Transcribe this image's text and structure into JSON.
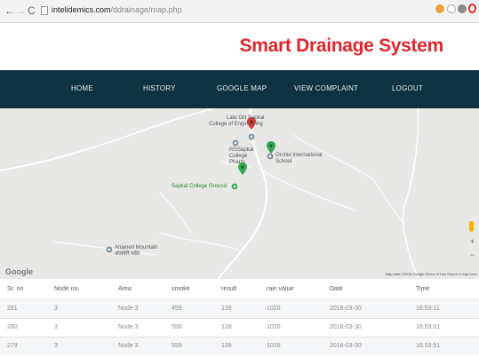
{
  "browser": {
    "back": "←",
    "forward": "→",
    "reload": "C",
    "url_host": "intelidemics.com",
    "url_path": "/ddrainage/map.php"
  },
  "site": {
    "title": "Smart Drainage System",
    "title_color": "#e0262c",
    "nav_color": "#0d3340"
  },
  "nav": {
    "items": [
      "HOME",
      "HISTORY",
      "GOOGLE MAP",
      "VIEW COMPLAINT",
      "LOGOUT"
    ]
  },
  "map": {
    "pois": {
      "late_gn": "Late GN Sapkal College of Engineering",
      "late_gn_l1": "Late GN Sapkal",
      "late_gn_l2": "College of Engineering",
      "rg_l1": "RGSapkal",
      "rg_l2": "College",
      "rg_l3": "Pharm",
      "orchid_l1": "Orchid International",
      "orchid_l2": "School",
      "ground": "Sapkal College Ground",
      "anjaneri_l1": "Anjaneri Mountain",
      "anjaneri_l2": "अंजनेरी पर्वत"
    },
    "logo": "Google",
    "credit": "Map data ©2018 Google   Terms of Use   Report a map error",
    "zoom_in": "+",
    "zoom_out": "−",
    "marker_color": "#e53935",
    "pin_color": "#34a853"
  },
  "table": {
    "headers": [
      "Sr. no",
      "Node no.",
      "Area",
      "smoke",
      "result",
      "rain value",
      "Date",
      "Time"
    ],
    "rows": [
      [
        "281",
        "3",
        "Node 3",
        "459",
        "139",
        "1020",
        "2018-03-30",
        "16:53:11"
      ],
      [
        "280",
        "3",
        "Node 3",
        "559",
        "139",
        "1020",
        "2018-03-30",
        "16:53:01"
      ],
      [
        "279",
        "3",
        "Node 3",
        "559",
        "139",
        "1020",
        "2018-03-30",
        "16:53:51"
      ]
    ]
  }
}
